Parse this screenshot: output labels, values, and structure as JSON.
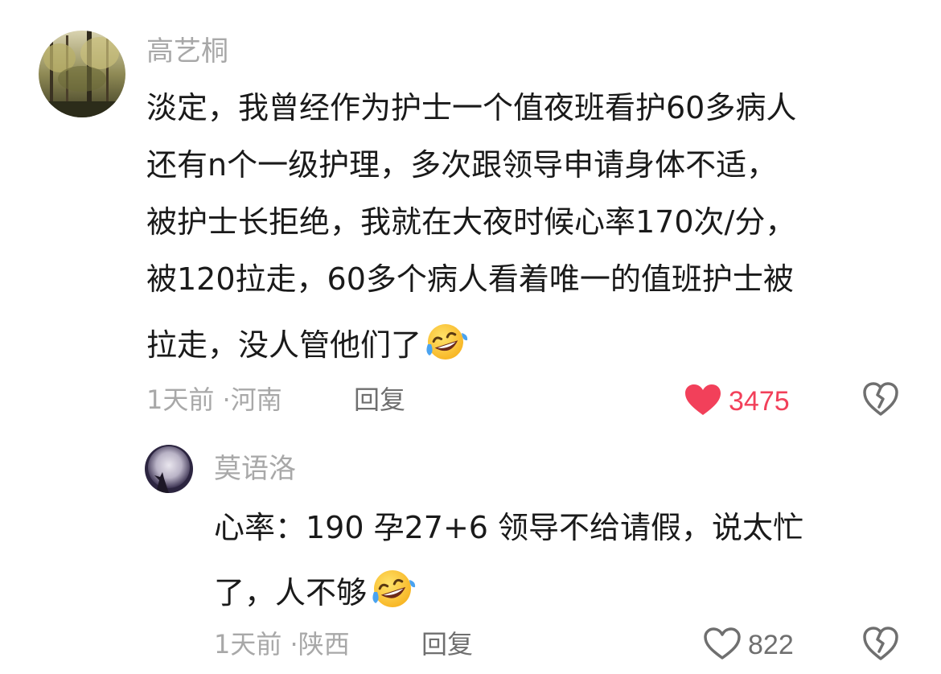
{
  "comments": [
    {
      "username": "高艺桐",
      "lines": [
        "淡定，我曾经作为护士一个值夜班看护60多病人",
        "还有n个一级护理，多次跟领导申请身体不适，",
        "被护士长拒绝，我就在大夜时候心率170次/分，",
        "被120拉走，60多个病人看着唯一的值班护士被",
        "拉走，没人管他们了"
      ],
      "emoji": "face-with-tears-of-joy",
      "time": "1天前",
      "separator": "·",
      "location": "河南",
      "reply_label": "回复",
      "like_count": "3475",
      "liked": true
    },
    {
      "username": "莫语洛",
      "lines": [
        "心率：190  孕27+6  领导不给请假，说太忙",
        "了，人不够"
      ],
      "emoji": "face-with-tears-of-joy",
      "time": "1天前",
      "separator": "·",
      "location": "陕西",
      "reply_label": "回复",
      "like_count": "822",
      "liked": false
    }
  ],
  "colors": {
    "text": "#1a1a1a",
    "muted": "#a8a8a8",
    "reply": "#6f6f6f",
    "like_active": "#f2405a",
    "like_inactive": "#6f6f6f"
  },
  "icons": {
    "like": "heart-icon",
    "dislike": "broken-heart-icon"
  }
}
